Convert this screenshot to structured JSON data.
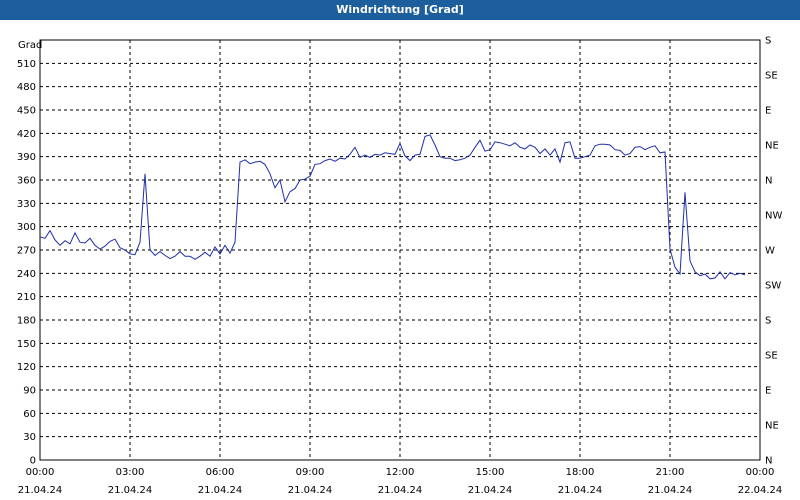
{
  "title": "Windrichtung [Grad]",
  "chart_data": {
    "type": "line",
    "title": "Windrichtung [Grad]",
    "ylabel": "Grad",
    "ylim": [
      0,
      540
    ],
    "yticks": [
      0,
      30,
      60,
      90,
      120,
      150,
      180,
      210,
      240,
      270,
      300,
      330,
      360,
      390,
      420,
      450,
      480,
      510
    ],
    "right_ticks": [
      {
        "value": 0,
        "label": "N"
      },
      {
        "value": 45,
        "label": "NE"
      },
      {
        "value": 90,
        "label": "E"
      },
      {
        "value": 135,
        "label": "SE"
      },
      {
        "value": 180,
        "label": "S"
      },
      {
        "value": 225,
        "label": "SW"
      },
      {
        "value": 270,
        "label": "W"
      },
      {
        "value": 315,
        "label": "NW"
      },
      {
        "value": 360,
        "label": "N"
      },
      {
        "value": 405,
        "label": "NE"
      },
      {
        "value": 450,
        "label": "E"
      },
      {
        "value": 495,
        "label": "SE"
      },
      {
        "value": 540,
        "label": "S"
      }
    ],
    "xlim": [
      "21.04.24 00:00",
      "22.04.24 00:00"
    ],
    "xticks": [
      {
        "time": "00:00",
        "date": "21.04.24"
      },
      {
        "time": "03:00",
        "date": "21.04.24"
      },
      {
        "time": "06:00",
        "date": "21.04.24"
      },
      {
        "time": "09:00",
        "date": "21.04.24"
      },
      {
        "time": "12:00",
        "date": "21.04.24"
      },
      {
        "time": "15:00",
        "date": "21.04.24"
      },
      {
        "time": "18:00",
        "date": "21.04.24"
      },
      {
        "time": "21:00",
        "date": "21.04.24"
      },
      {
        "time": "00:00",
        "date": "22.04.24"
      }
    ],
    "grid": true,
    "line_color": "#1f2fa8",
    "x": [
      "00:00",
      "00:10",
      "00:20",
      "00:30",
      "00:40",
      "00:50",
      "01:00",
      "01:10",
      "01:20",
      "01:30",
      "01:40",
      "01:50",
      "02:00",
      "02:10",
      "02:20",
      "02:30",
      "02:40",
      "02:50",
      "03:00",
      "03:10",
      "03:20",
      "03:30",
      "03:40",
      "03:50",
      "04:00",
      "04:10",
      "04:20",
      "04:30",
      "04:40",
      "04:50",
      "05:00",
      "05:10",
      "05:20",
      "05:30",
      "05:40",
      "05:50",
      "06:00",
      "06:10",
      "06:20",
      "06:30",
      "06:40",
      "06:50",
      "07:00",
      "07:10",
      "07:20",
      "07:30",
      "07:40",
      "07:50",
      "08:00",
      "08:10",
      "08:20",
      "08:30",
      "08:40",
      "08:50",
      "09:00",
      "09:10",
      "09:20",
      "09:30",
      "09:40",
      "09:50",
      "10:00",
      "10:10",
      "10:20",
      "10:30",
      "10:40",
      "10:50",
      "11:00",
      "11:10",
      "11:20",
      "11:30",
      "11:40",
      "11:50",
      "12:00",
      "12:10",
      "12:20",
      "12:30",
      "12:40",
      "12:50",
      "13:00",
      "13:10",
      "13:20",
      "13:30",
      "13:40",
      "13:50",
      "14:00",
      "14:10",
      "14:20",
      "14:30",
      "14:40",
      "14:50",
      "15:00",
      "15:10",
      "15:20",
      "15:30",
      "15:40",
      "15:50",
      "16:00",
      "16:10",
      "16:20",
      "16:30",
      "16:40",
      "16:50",
      "17:00",
      "17:10",
      "17:20",
      "17:30",
      "17:40",
      "17:50",
      "18:00",
      "18:10",
      "18:20",
      "18:30",
      "18:40",
      "18:50",
      "19:00",
      "19:10",
      "19:20",
      "19:30",
      "19:40",
      "19:50",
      "20:00",
      "20:10",
      "20:20",
      "20:30",
      "20:40",
      "20:50",
      "21:00",
      "21:10",
      "21:20",
      "21:30",
      "21:40",
      "21:50",
      "22:00",
      "22:10",
      "22:20",
      "22:30",
      "22:40",
      "22:50",
      "23:00",
      "23:10",
      "23:20",
      "23:30",
      "23:40",
      "23:50"
    ],
    "y": [
      287,
      285,
      295,
      283,
      276,
      282,
      278,
      292,
      280,
      279,
      285,
      276,
      271,
      275,
      281,
      284,
      273,
      270,
      265,
      264,
      280,
      368,
      270,
      263,
      268,
      263,
      259,
      262,
      268,
      262,
      262,
      258,
      262,
      267,
      262,
      274,
      265,
      276,
      266,
      280,
      383,
      386,
      381,
      383,
      384,
      380,
      368,
      350,
      360,
      332,
      345,
      349,
      360,
      361,
      365,
      380,
      381,
      385,
      387,
      384,
      388,
      387,
      393,
      402,
      389,
      392,
      389,
      393,
      392,
      395,
      394,
      393,
      407,
      391,
      385,
      392,
      393,
      416,
      418,
      405,
      390,
      388,
      388,
      385,
      386,
      388,
      392,
      402,
      411,
      397,
      399,
      409,
      408,
      406,
      404,
      408,
      402,
      400,
      405,
      402,
      394,
      400,
      392,
      400,
      383,
      408,
      409,
      388,
      388,
      390,
      392,
      404,
      406,
      406,
      405,
      399,
      398,
      392,
      394,
      402,
      403,
      399,
      402,
      404,
      395,
      396,
      271,
      248,
      239,
      344,
      256,
      242,
      237,
      239,
      233,
      234,
      242,
      233,
      241,
      238,
      240,
      238
    ]
  }
}
